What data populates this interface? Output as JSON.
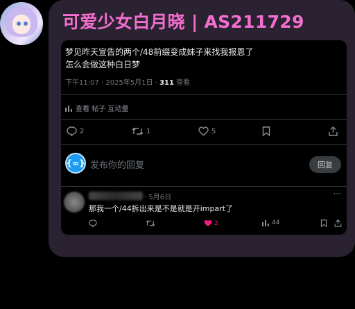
{
  "header": {
    "title": "可爱少女白月晓 | AS211729"
  },
  "post": {
    "text_line1": "梦见昨天宣告的两个/48前缀变成妹子来找我报恩了",
    "text_line2": "怎么会做这种白日梦",
    "time": "下午11:07 · 2025年5月1日 · ",
    "views_count": "311",
    "views_label": " 查看",
    "engagement_label": "查看 帖子 互动量",
    "actions": {
      "replies": "2",
      "reposts": "1",
      "likes": "5"
    }
  },
  "reply_box": {
    "avatar_text": "{∞}",
    "placeholder": "发布你的回复",
    "button_label": "回复"
  },
  "comment": {
    "date": "· 5月6日",
    "more": "···",
    "text": "那我一个/44拆出来是不是就是开impart了",
    "likes": "2",
    "views": "44"
  },
  "colors": {
    "title": "#f26fcf",
    "bubble": "#2b2231",
    "like_active": "#f91880",
    "accent": "#1d9bf0"
  }
}
